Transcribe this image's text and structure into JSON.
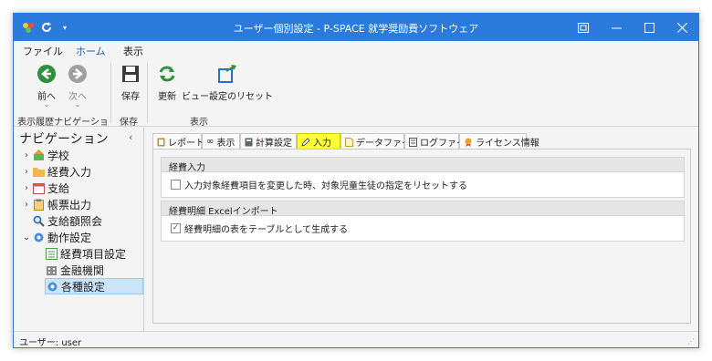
{
  "window": {
    "title": "ユーザー個別設定 - P-SPACE 就学奨励費ソフトウェア"
  },
  "menu": [
    "ファイル",
    "ホーム",
    "表示"
  ],
  "ribbon": {
    "back_label": "前へ",
    "forward_label": "次へ",
    "save_label": "保存",
    "refresh_label": "更新",
    "reset_view_label": "ビュー設定のリセット",
    "group_history": "表示履歴ナビゲーション",
    "group_save": "保存",
    "group_view": "表示"
  },
  "nav": {
    "title": "ナビゲーション",
    "items": [
      {
        "label": "学校",
        "icon": "school-icon"
      },
      {
        "label": "経費入力",
        "icon": "folder-icon"
      },
      {
        "label": "支給",
        "icon": "calendar-icon"
      },
      {
        "label": "帳票出力",
        "icon": "clipboard-icon"
      },
      {
        "label": "支給額照会",
        "icon": "search-icon"
      },
      {
        "label": "動作設定",
        "icon": "gear-icon"
      },
      {
        "label": "経費項目設定",
        "icon": "list-icon"
      },
      {
        "label": "金融機関",
        "icon": "building-icon"
      },
      {
        "label": "各種設定",
        "icon": "gear-icon"
      }
    ]
  },
  "tabs": [
    {
      "label": "レポート",
      "icon": "report-icon"
    },
    {
      "label": "表示",
      "icon": "glasses-icon"
    },
    {
      "label": "計算設定",
      "icon": "calculator-icon"
    },
    {
      "label": "入力",
      "icon": "pencil-icon"
    },
    {
      "label": "データファイル",
      "icon": "file-icon"
    },
    {
      "label": "ログファイル",
      "icon": "log-icon"
    },
    {
      "label": "ライセンス情報",
      "icon": "license-icon"
    }
  ],
  "groups": {
    "input_title": "経費入力",
    "input_option": "入力対象経費項目を変更した時、対象児童生徒の指定をリセットする",
    "excel_title": "経費明細 Excelインポート",
    "excel_option": "経費明細の表をテーブルとして生成する"
  },
  "status": {
    "user": "ユーザー: user"
  },
  "colors": {
    "titlebar": "#2b7bdc",
    "active_tab": "#ffff33",
    "selection": "#cce4fa"
  }
}
